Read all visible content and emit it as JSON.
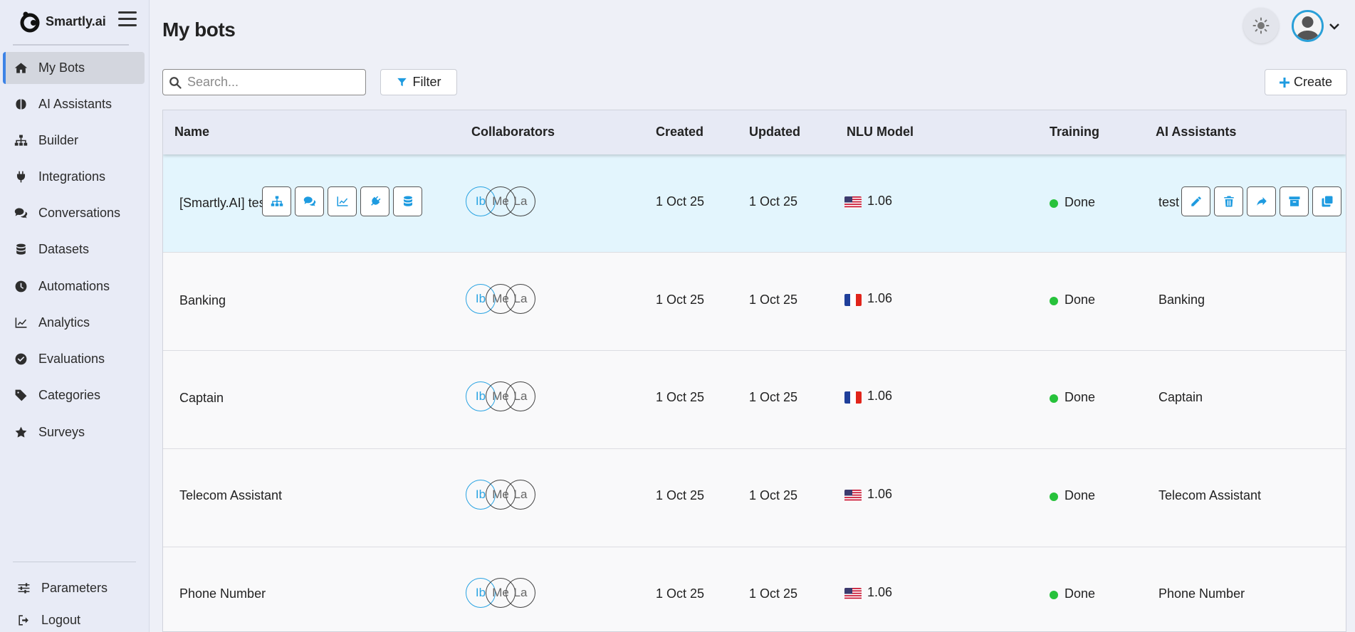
{
  "brand": {
    "name": "Smartly.ai"
  },
  "sidebar": {
    "items": [
      {
        "label": "My Bots",
        "icon": "home-icon",
        "active": true
      },
      {
        "label": "AI Assistants",
        "icon": "brain-icon"
      },
      {
        "label": "Builder",
        "icon": "sitemap-icon"
      },
      {
        "label": "Integrations",
        "icon": "plug-icon"
      },
      {
        "label": "Conversations",
        "icon": "comments-icon"
      },
      {
        "label": "Datasets",
        "icon": "database-icon"
      },
      {
        "label": "Automations",
        "icon": "clock-icon"
      },
      {
        "label": "Analytics",
        "icon": "chart-line-icon"
      },
      {
        "label": "Evaluations",
        "icon": "check-circle-icon"
      },
      {
        "label": "Categories",
        "icon": "tag-icon"
      },
      {
        "label": "Surveys",
        "icon": "star-icon"
      }
    ],
    "bottom": [
      {
        "label": "Parameters",
        "icon": "sliders-icon"
      },
      {
        "label": "Logout",
        "icon": "logout-icon"
      }
    ]
  },
  "header": {
    "title": "My bots"
  },
  "toolbar": {
    "search_placeholder": "Search...",
    "filter_label": "Filter",
    "create_label": "Create"
  },
  "table": {
    "columns": [
      "Name",
      "Collaborators",
      "Created",
      "Updated",
      "NLU Model",
      "Training",
      "AI Assistants"
    ],
    "rows": [
      {
        "name": "[Smartly.AI] test",
        "collaborators": [
          "Ib",
          "Me",
          "La"
        ],
        "created": "1 Oct 25",
        "updated": "1 Oct 25",
        "flag": "us",
        "nlu": "1.06",
        "training": "Done",
        "assistant": "test"
      },
      {
        "name": "Banking",
        "collaborators": [
          "Ib",
          "Me",
          "La"
        ],
        "created": "1 Oct 25",
        "updated": "1 Oct 25",
        "flag": "fr",
        "nlu": "1.06",
        "training": "Done",
        "assistant": "Banking"
      },
      {
        "name": "Captain",
        "collaborators": [
          "Ib",
          "Me",
          "La"
        ],
        "created": "1 Oct 25",
        "updated": "1 Oct 25",
        "flag": "fr",
        "nlu": "1.06",
        "training": "Done",
        "assistant": "Captain"
      },
      {
        "name": "Telecom Assistant",
        "collaborators": [
          "Ib",
          "Me",
          "La"
        ],
        "created": "1 Oct 25",
        "updated": "1 Oct 25",
        "flag": "us",
        "nlu": "1.06",
        "training": "Done",
        "assistant": "Telecom Assistant"
      },
      {
        "name": "Phone Number",
        "collaborators": [
          "Ib",
          "Me",
          "La"
        ],
        "created": "1 Oct 25",
        "updated": "1 Oct 25",
        "flag": "us",
        "nlu": "1.06",
        "training": "Done",
        "assistant": "Phone Number"
      }
    ],
    "row_hover_actions_left": [
      "sitemap-icon",
      "comments-icon",
      "chart-line-icon",
      "plug-icon",
      "database-icon"
    ],
    "row_hover_actions_right": [
      "pencil-icon",
      "trash-icon",
      "share-icon",
      "archive-icon",
      "copy-icon"
    ]
  },
  "colors": {
    "accent": "#1e9be0",
    "status_done": "#27c23b",
    "highlight_row": "#e3f5fd",
    "sidebar_bg": "#e8ebf6",
    "active_indicator": "#3d83e6"
  }
}
